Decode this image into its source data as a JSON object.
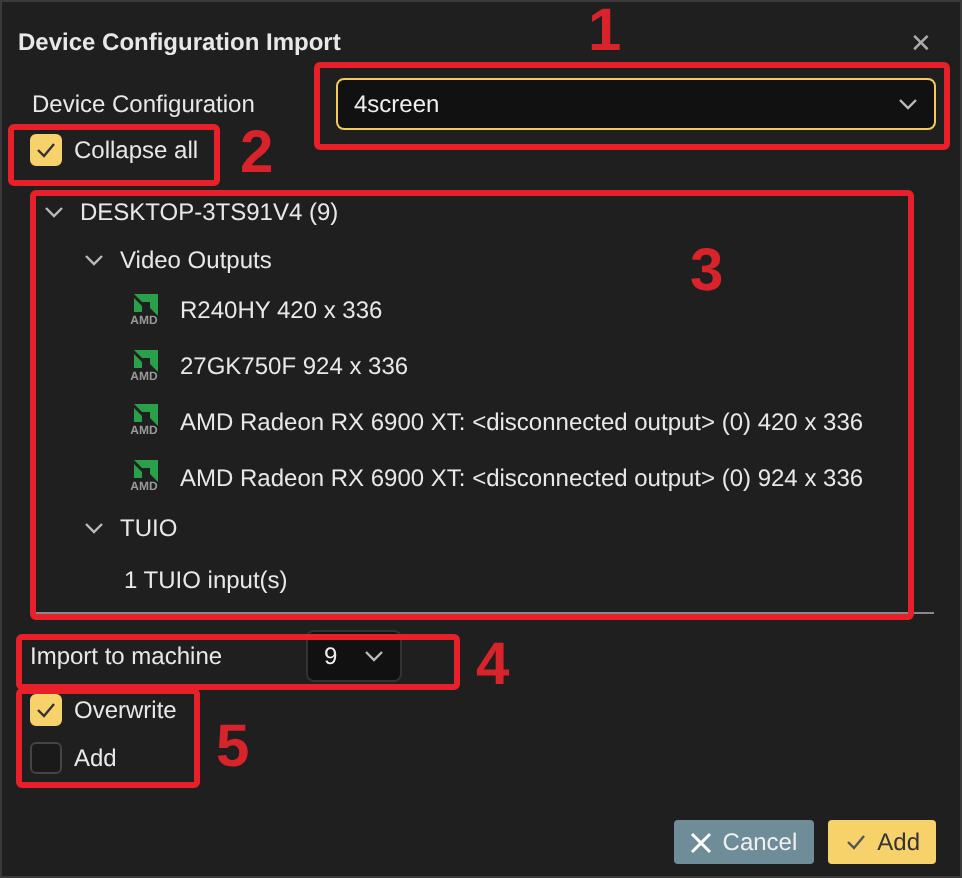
{
  "window": {
    "title": "Device Configuration Import",
    "close": "✕"
  },
  "device_configuration": {
    "label": "Device Configuration",
    "value": "4screen",
    "focused": true
  },
  "collapse_all": {
    "label": "Collapse all",
    "checked": true
  },
  "tree": [
    {
      "label": "DESKTOP-3TS91V4 (9)",
      "expanded": true,
      "children": [
        {
          "label": "Video Outputs",
          "expanded": true,
          "children": [
            {
              "label": "R240HY 420 x 336",
              "icon_text": "AMD"
            },
            {
              "label": "27GK750F 924 x 336",
              "icon_text": "AMD"
            },
            {
              "label": "AMD Radeon RX 6900 XT: <disconnected output> (0) 420 x 336",
              "icon_text": "AMD"
            },
            {
              "label": "AMD Radeon RX 6900 XT: <disconnected output> (0) 924 x 336",
              "icon_text": "AMD"
            }
          ]
        },
        {
          "label": "TUIO",
          "expanded": true,
          "children": [
            {
              "label": "1 TUIO input(s)"
            }
          ]
        }
      ]
    }
  ],
  "import_to_machine": {
    "label": "Import to machine",
    "value": "9"
  },
  "options": [
    {
      "label": "Overwrite",
      "checked": true
    },
    {
      "label": "Add",
      "checked": false
    }
  ],
  "buttons": [
    {
      "kind": "cancel",
      "label": "Cancel"
    },
    {
      "kind": "confirm",
      "label": "Add"
    }
  ],
  "callouts": [
    {
      "number": "1"
    },
    {
      "number": "2"
    },
    {
      "number": "3"
    },
    {
      "number": "4"
    },
    {
      "number": "5"
    }
  ]
}
